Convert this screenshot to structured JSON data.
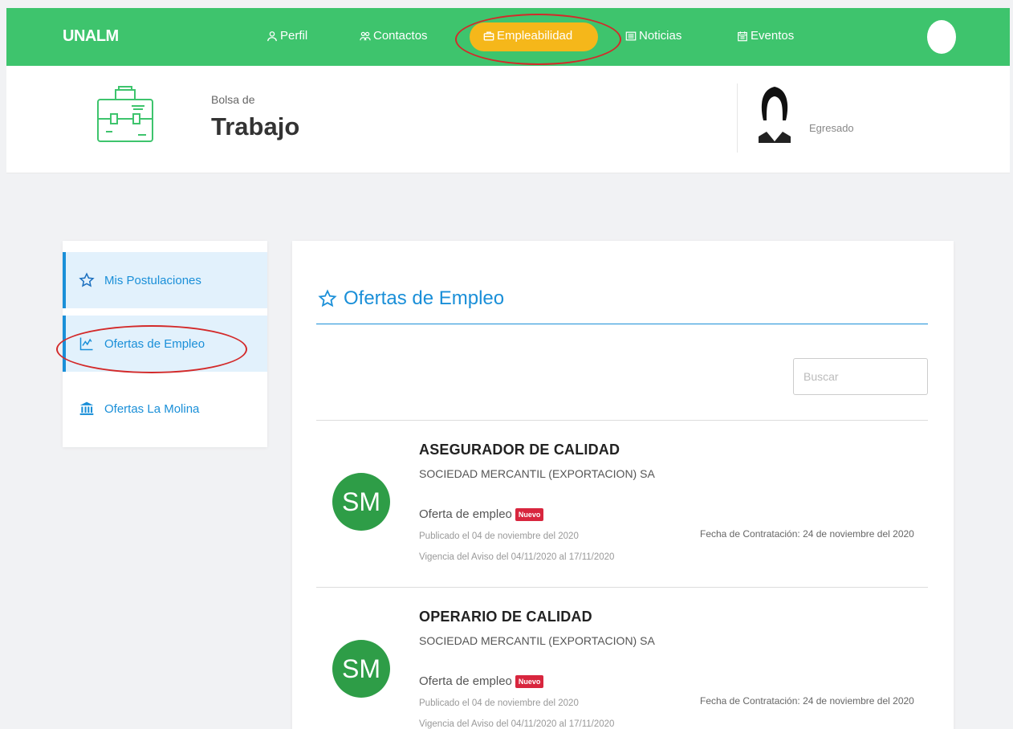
{
  "nav": {
    "brand": "UNALM",
    "items": [
      {
        "label": "Perfil",
        "icon": "user-icon"
      },
      {
        "label": "Contactos",
        "icon": "people-icon"
      },
      {
        "label": "Empleabilidad",
        "icon": "briefcase-icon"
      },
      {
        "label": "Noticias",
        "icon": "newspaper-icon"
      },
      {
        "label": "Eventos",
        "icon": "calendar-icon"
      }
    ],
    "active_color": "#f5b71a",
    "bar_color": "#3ec46d"
  },
  "header": {
    "subtitle": "Bolsa de",
    "title": "Trabajo",
    "user_role": "Egresado"
  },
  "sidebar": {
    "items": [
      {
        "label": "Mis Postulaciones",
        "icon": "star-icon"
      },
      {
        "label": "Ofertas de Empleo",
        "icon": "chart-icon"
      },
      {
        "label": "Ofertas La Molina",
        "icon": "bank-icon"
      }
    ]
  },
  "main": {
    "title": "Ofertas de Empleo",
    "search_placeholder": "Buscar",
    "jobs": [
      {
        "initials": "SM",
        "title": "ASEGURADOR DE CALIDAD",
        "company": "SOCIEDAD MERCANTIL (EXPORTACION) SA",
        "type": "Oferta de empleo",
        "badge": "Nuevo",
        "published": "Publicado el 04 de noviembre del 2020",
        "validity": "Vigencia del Aviso del 04/11/2020 al 17/11/2020",
        "hire_date": "Fecha de Contratación: 24 de noviembre del 2020"
      },
      {
        "initials": "SM",
        "title": "OPERARIO DE CALIDAD",
        "company": "SOCIEDAD MERCANTIL (EXPORTACION) SA",
        "type": "Oferta de empleo",
        "badge": "Nuevo",
        "published": "Publicado el 04 de noviembre del 2020",
        "validity": "Vigencia del Aviso del 04/11/2020 al 17/11/2020",
        "hire_date": "Fecha de Contratación: 24 de noviembre del 2020"
      }
    ]
  }
}
